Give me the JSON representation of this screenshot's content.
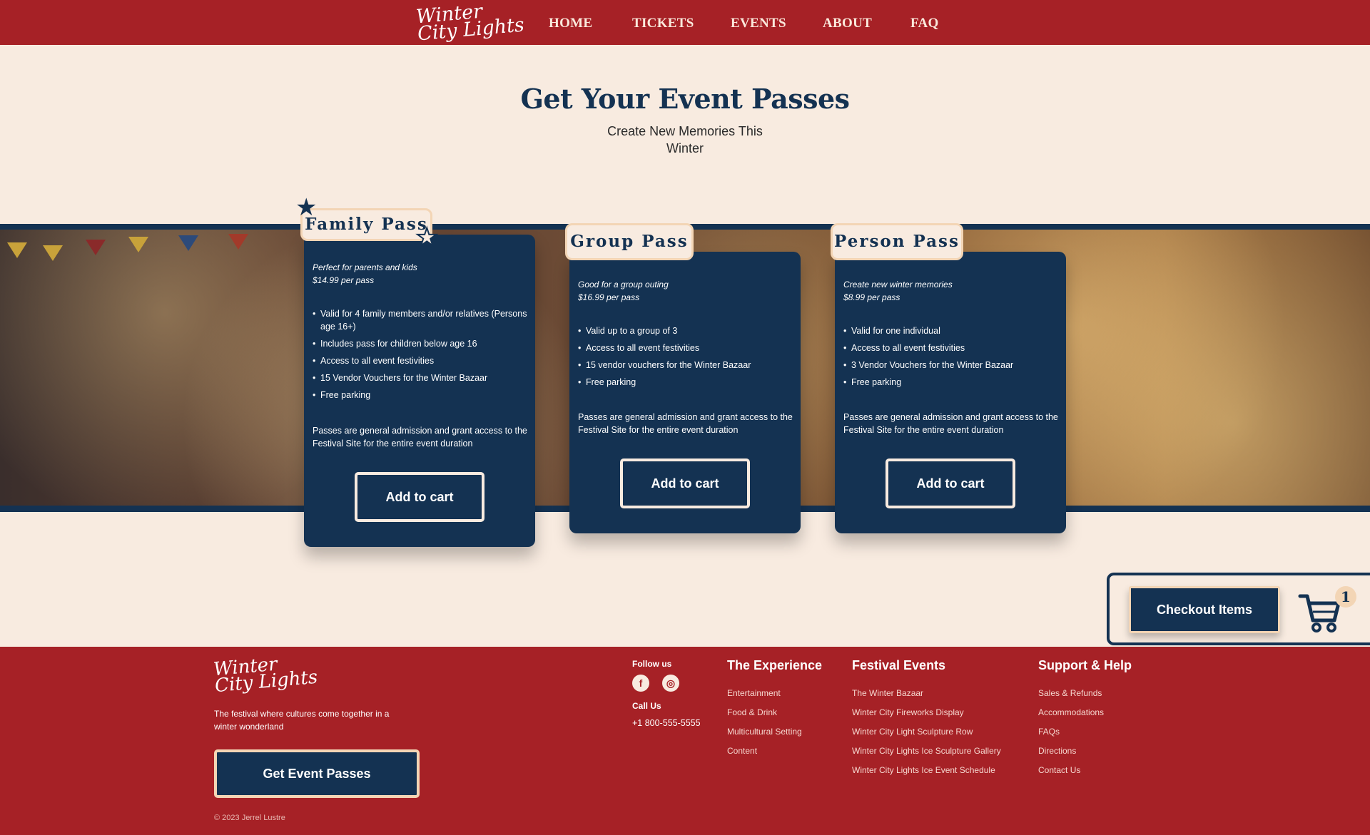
{
  "brand": {
    "logo_line1": "Winter",
    "logo_line2": "City Lights"
  },
  "nav": {
    "items": [
      {
        "label": "HOME"
      },
      {
        "label": "TICKETS"
      },
      {
        "label": "EVENTS"
      },
      {
        "label": "ABOUT"
      },
      {
        "label": "FAQ"
      }
    ]
  },
  "hero": {
    "title": "Get Your Event Passes",
    "subtitle": "Create New Memories This Winter"
  },
  "passes": [
    {
      "name": "Family Pass",
      "tagline": "Perfect for parents and kids",
      "price": "$14.99 per pass",
      "features": [
        "Valid for 4 family members and/or relatives (Persons age 16+)",
        "Includes pass for children below age 16",
        "Access to all event festivities",
        "15 Vendor Vouchers for the Winter Bazaar",
        "Free parking"
      ],
      "terms": "Passes are general admission and grant access to the Festival Site for the entire event duration",
      "button": "Add to cart"
    },
    {
      "name": "Group Pass",
      "tagline": "Good for a group outing",
      "price": "$16.99 per pass",
      "features": [
        "Valid up to a group of 3",
        "Access to all event festivities",
        "15 vendor vouchers for the Winter Bazaar",
        "Free parking"
      ],
      "terms": "Passes are general admission and grant access to the Festival Site for the entire event duration",
      "button": "Add to cart"
    },
    {
      "name": "Person Pass",
      "tagline": "Create new winter memories",
      "price": "$8.99 per pass",
      "features": [
        "Valid for one individual",
        "Access to all event festivities",
        "3 Vendor Vouchers for the Winter Bazaar",
        "Free parking"
      ],
      "terms": "Passes are general admission and grant access to the Festival Site for the entire event duration",
      "button": "Add to cart"
    }
  ],
  "checkout": {
    "label": "Checkout Items",
    "cart_count": "1",
    "icon": "shopping-cart-icon"
  },
  "footer": {
    "tagline": "The festival where cultures come together in a winter wonderland",
    "cta": "Get Event Passes",
    "copyright": "© 2023 Jerrel Lustre",
    "follow_label": "Follow us",
    "social": [
      {
        "icon": "facebook-icon",
        "glyph": "f"
      },
      {
        "icon": "instagram-icon",
        "glyph": "◎"
      }
    ],
    "call_label": "Call Us",
    "phone": "+1 800-555-5555",
    "columns": [
      {
        "title": "The Experience",
        "links": [
          "Entertainment",
          "Food & Drink",
          "Multicultural Setting",
          "Content"
        ]
      },
      {
        "title": "Festival Events",
        "links": [
          "The Winter Bazaar",
          "Winter City Fireworks Display",
          "Winter City Light Sculpture Row",
          "Winter City Lights Ice Sculpture Gallery",
          "Winter City Lights Ice Event Schedule"
        ]
      },
      {
        "title": "Support & Help",
        "links": [
          "Sales & Refunds",
          "Accommodations",
          "FAQs",
          "Directions",
          "Contact Us"
        ]
      }
    ]
  },
  "colors": {
    "brand_red": "#a62126",
    "navy": "#143252",
    "cream": "#f8ebe0",
    "gold_border": "#f3d5b5"
  }
}
